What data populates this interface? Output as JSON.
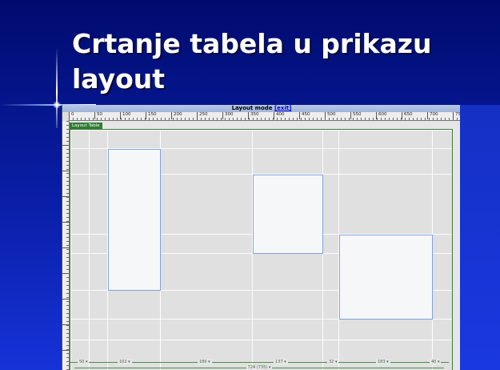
{
  "slide": {
    "title": "Crtanje tabela u prikazu layout"
  },
  "screenshot": {
    "mode_bar": {
      "label": "Layout mode",
      "exit_label": "[exit]"
    },
    "ruler_labels": [
      "0",
      "50",
      "100",
      "150",
      "200",
      "250",
      "300",
      "350",
      "400",
      "450",
      "500",
      "550",
      "600",
      "650",
      "700",
      "75"
    ],
    "layout_table_tab": "Layout Table",
    "column_widths": [
      "50 ▾",
      "102 ▾",
      "180 ▾",
      "137 ▾",
      "32 ▾",
      "183 ▾",
      "40 ▾"
    ],
    "total_width": "724 (735) ▾",
    "colors": {
      "slide_bg_top": "#000b6e",
      "slide_bg_bottom": "#1633d8",
      "table_border": "#3f7a3f",
      "cell_border": "#7fa3e0",
      "tab_bg": "#2f7d32"
    }
  }
}
